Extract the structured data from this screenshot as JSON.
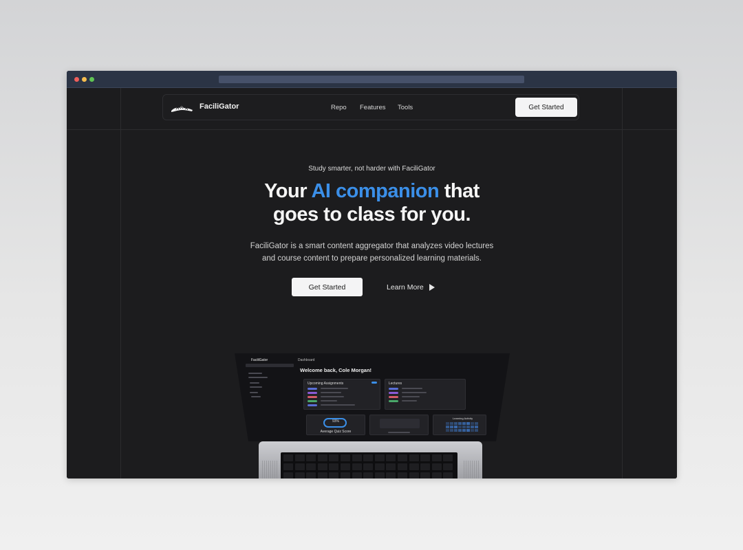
{
  "nav": {
    "brand": "FaciliGator",
    "links": [
      "Repo",
      "Features",
      "Tools"
    ],
    "cta": "Get Started"
  },
  "hero": {
    "eyebrow": "Study smarter, not harder with FaciliGator",
    "headline_pre": "Your ",
    "headline_accent": "AI companion",
    "headline_post": " that",
    "headline_line2": "goes to class for you.",
    "subtitle_line1": "FaciliGator is a smart content aggregator that analyzes video lectures",
    "subtitle_line2": "and course content to prepare personalized learning materials.",
    "primary_button": "Get Started",
    "secondary_button": "Learn More"
  },
  "mockup": {
    "app_name": "FaciliGator",
    "page_label": "Dashboard",
    "welcome": "Welcome back, Cole Morgan!",
    "card_assignments": "Upcoming Assignments",
    "card_lectures": "Lectures",
    "card_learning": "Learning Activity",
    "gauge_value": "93%",
    "gauge_label": "Average Quiz Score"
  },
  "colors": {
    "accent": "#3b8fe8",
    "background": "#1c1c1e",
    "button": "#f4f4f5"
  }
}
